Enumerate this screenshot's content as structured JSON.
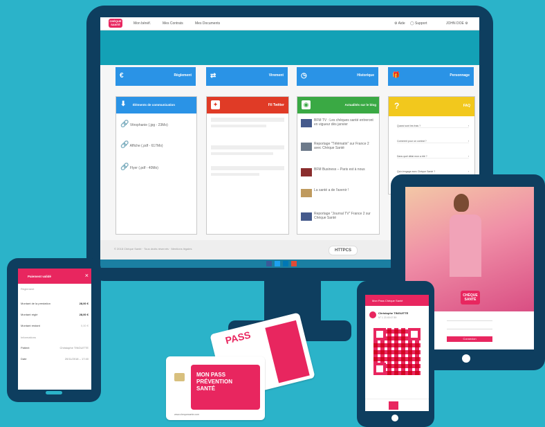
{
  "monitor": {
    "nav": {
      "logo_line1": "CHÈQUE",
      "logo_line2": "SANTÉ",
      "item1": "Mon bénéf.",
      "item2": "Mes Contrats",
      "item3": "Mes Documents",
      "aide": "Aide",
      "support": "Support",
      "user": "JOHN DOE"
    },
    "tiles": [
      {
        "label": "Règlement",
        "icon": "€"
      },
      {
        "label": "Virement",
        "icon": "⇄"
      },
      {
        "label": "Historique",
        "icon": "◷"
      },
      {
        "label": "Personnage",
        "icon": "🎁"
      }
    ],
    "comm": {
      "title": "Éléments de communication",
      "items": [
        "Vitrophanie (.jpg - 23Mo)",
        "Affiche (.pdf - 617Mo)",
        "Flyer (.pdf - 40Mo)"
      ]
    },
    "twitter": {
      "title": "Fil Twitter"
    },
    "blog": {
      "title": "Actualités sur le blog",
      "items": [
        "BFM TV : Les chèques santé entreront en vigueur dès janvier",
        "Reportage \"Télématin\" sur France 2 avec Chèque Santé",
        "BFM Business – Paris est à nous",
        "La santé a de l'avenir !",
        "Reportage \"Journal TV\" France 2 sur Chèque Santé"
      ]
    },
    "faq": {
      "title": "FAQ",
      "items": [
        "Quand sont les frais ?",
        "Comment pour un contrat ?",
        "Dans quel délai mon a été ?",
        "Qui s'engage avec Chèque Santé ?",
        "Comment créer ?"
      ]
    },
    "footer": {
      "text": "© 2018 Chèque Santé · Tous droits réservés · Mentions légales",
      "httpcs": "HTTPCS"
    }
  },
  "phone_left": {
    "header": "Paiement validé",
    "section1": "Règlement",
    "rows": [
      {
        "label": "Montant de la prestation",
        "value": "28,00 €"
      },
      {
        "label": "Montant réglé",
        "value": "28,00 €"
      },
      {
        "label": "Montant restant",
        "value": "0,00 €"
      }
    ],
    "section2": "Informations",
    "rows2": [
      {
        "label": "Patient",
        "value": "Christophe TINGUITTE"
      },
      {
        "label": "Date",
        "value": "20/11/2018 – 17:40"
      }
    ]
  },
  "card": {
    "line1": "MON PASS",
    "line2": "PRÉVENTION",
    "line3": "SANTÉ",
    "back_text": "PASS",
    "url": "www.chequesante.com"
  },
  "phone_right": {
    "header": "Mon Pass Chèque Santé",
    "name": "Christophe TINGUITTE",
    "sub": "N° 1 23 45 67 89"
  },
  "tablet": {
    "logo_line1": "CHÈQUE",
    "logo_line2": "SANTÉ",
    "button": "Connexion"
  },
  "colors": {
    "teal": "#2bb3c9",
    "navy": "#0e3e5f",
    "pink": "#e8265f",
    "blue": "#2a93e6"
  }
}
